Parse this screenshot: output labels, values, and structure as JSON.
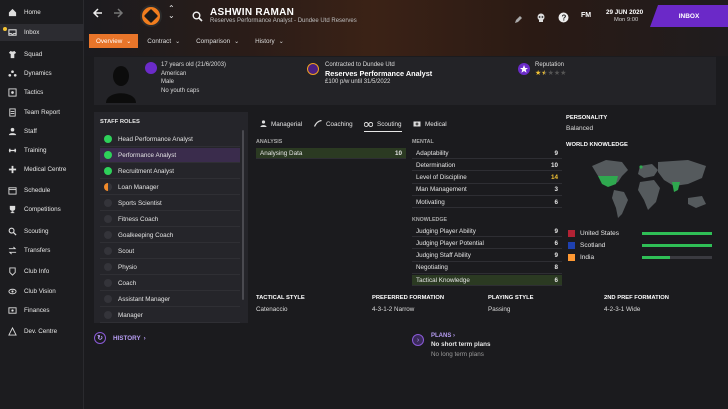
{
  "sidebar": {
    "items": [
      {
        "label": "Home",
        "icon": "home-icon"
      },
      {
        "label": "Inbox",
        "icon": "inbox-icon"
      },
      {
        "label": "Squad",
        "icon": "shirt-icon"
      },
      {
        "label": "Dynamics",
        "icon": "dynamics-icon"
      },
      {
        "label": "Tactics",
        "icon": "tactics-icon"
      },
      {
        "label": "Team Report",
        "icon": "report-icon"
      },
      {
        "label": "Staff",
        "icon": "staff-icon"
      },
      {
        "label": "Training",
        "icon": "training-icon"
      },
      {
        "label": "Medical Centre",
        "icon": "medical-icon"
      },
      {
        "label": "Schedule",
        "icon": "calendar-icon"
      },
      {
        "label": "Competitions",
        "icon": "trophy-icon"
      },
      {
        "label": "Scouting",
        "icon": "scouting-icon"
      },
      {
        "label": "Transfers",
        "icon": "transfers-icon"
      },
      {
        "label": "Club Info",
        "icon": "club-info-icon"
      },
      {
        "label": "Club Vision",
        "icon": "vision-icon"
      },
      {
        "label": "Finances",
        "icon": "finances-icon"
      },
      {
        "label": "Dev. Centre",
        "icon": "dev-centre-icon"
      }
    ]
  },
  "header": {
    "name": "ASHWIN RAMAN",
    "subtitle": "Reserves Performance Analyst - Dundee Utd Reserves",
    "fm_label": "FM",
    "date": "29 JUN 2020",
    "day": "Mon 9:00",
    "inbox_label": "INBOX",
    "tabs": [
      {
        "label": "Overview"
      },
      {
        "label": "Contract"
      },
      {
        "label": "Comparison"
      },
      {
        "label": "History"
      }
    ]
  },
  "info": {
    "age": "17 years old (21/6/2003)",
    "nationality": "American",
    "gender": "Male",
    "caps": "No youth caps",
    "contract_head": "Contracted to Dundee Utd",
    "role": "Reserves Performance Analyst",
    "wage": "£100 p/w until 31/5/2022",
    "reputation_label": "Reputation",
    "reputation_stars": 1.5
  },
  "roles": {
    "title": "STAFF ROLES",
    "items": [
      {
        "label": "Head Performance Analyst",
        "status": "green"
      },
      {
        "label": "Performance Analyst",
        "status": "green"
      },
      {
        "label": "Recruitment Analyst",
        "status": "green"
      },
      {
        "label": "Loan Manager",
        "status": "half"
      },
      {
        "label": "Sports Scientist",
        "status": "none"
      },
      {
        "label": "Fitness Coach",
        "status": "none"
      },
      {
        "label": "Goalkeeping Coach",
        "status": "none"
      },
      {
        "label": "Scout",
        "status": "none"
      },
      {
        "label": "Physio",
        "status": "none"
      },
      {
        "label": "Coach",
        "status": "none"
      },
      {
        "label": "Assistant Manager",
        "status": "none"
      },
      {
        "label": "Manager",
        "status": "none"
      }
    ]
  },
  "attr_tabs": [
    {
      "label": "Managerial"
    },
    {
      "label": "Coaching"
    },
    {
      "label": "Scouting"
    },
    {
      "label": "Medical"
    }
  ],
  "analysis": {
    "label": "ANALYSIS",
    "items": [
      {
        "label": "Analysing Data",
        "value": "10"
      }
    ]
  },
  "mental": {
    "label": "MENTAL",
    "items": [
      {
        "label": "Adaptability",
        "value": "9"
      },
      {
        "label": "Determination",
        "value": "10"
      },
      {
        "label": "Level of Discipline",
        "value": "14"
      },
      {
        "label": "Man Management",
        "value": "3"
      },
      {
        "label": "Motivating",
        "value": "6"
      }
    ]
  },
  "knowledge": {
    "label": "KNOWLEDGE",
    "items": [
      {
        "label": "Judging Player Ability",
        "value": "9"
      },
      {
        "label": "Judging Player Potential",
        "value": "6"
      },
      {
        "label": "Judging Staff Ability",
        "value": "9"
      },
      {
        "label": "Negotiating",
        "value": "8"
      },
      {
        "label": "Tactical Knowledge",
        "value": "6"
      }
    ]
  },
  "personality": {
    "label": "PERSONALITY",
    "value": "Balanced"
  },
  "world": {
    "label": "WORLD KNOWLEDGE",
    "countries": [
      {
        "label": "United States",
        "level": 1.0
      },
      {
        "label": "Scotland",
        "level": 1.0
      },
      {
        "label": "India",
        "level": 0.4
      }
    ]
  },
  "styles": {
    "tactical_label": "TACTICAL STYLE",
    "tactical": "Catenaccio",
    "formation_label": "PREFERRED FORMATION",
    "formation": "4-3-1-2 Narrow",
    "playing_label": "PLAYING STYLE",
    "playing": "Passing",
    "second_label": "2ND PREF FORMATION",
    "second": "4-2-3-1 Wide"
  },
  "history": {
    "label": "HISTORY"
  },
  "plans": {
    "label": "PLANS",
    "short": "No short term plans",
    "long": "No long term plans"
  }
}
